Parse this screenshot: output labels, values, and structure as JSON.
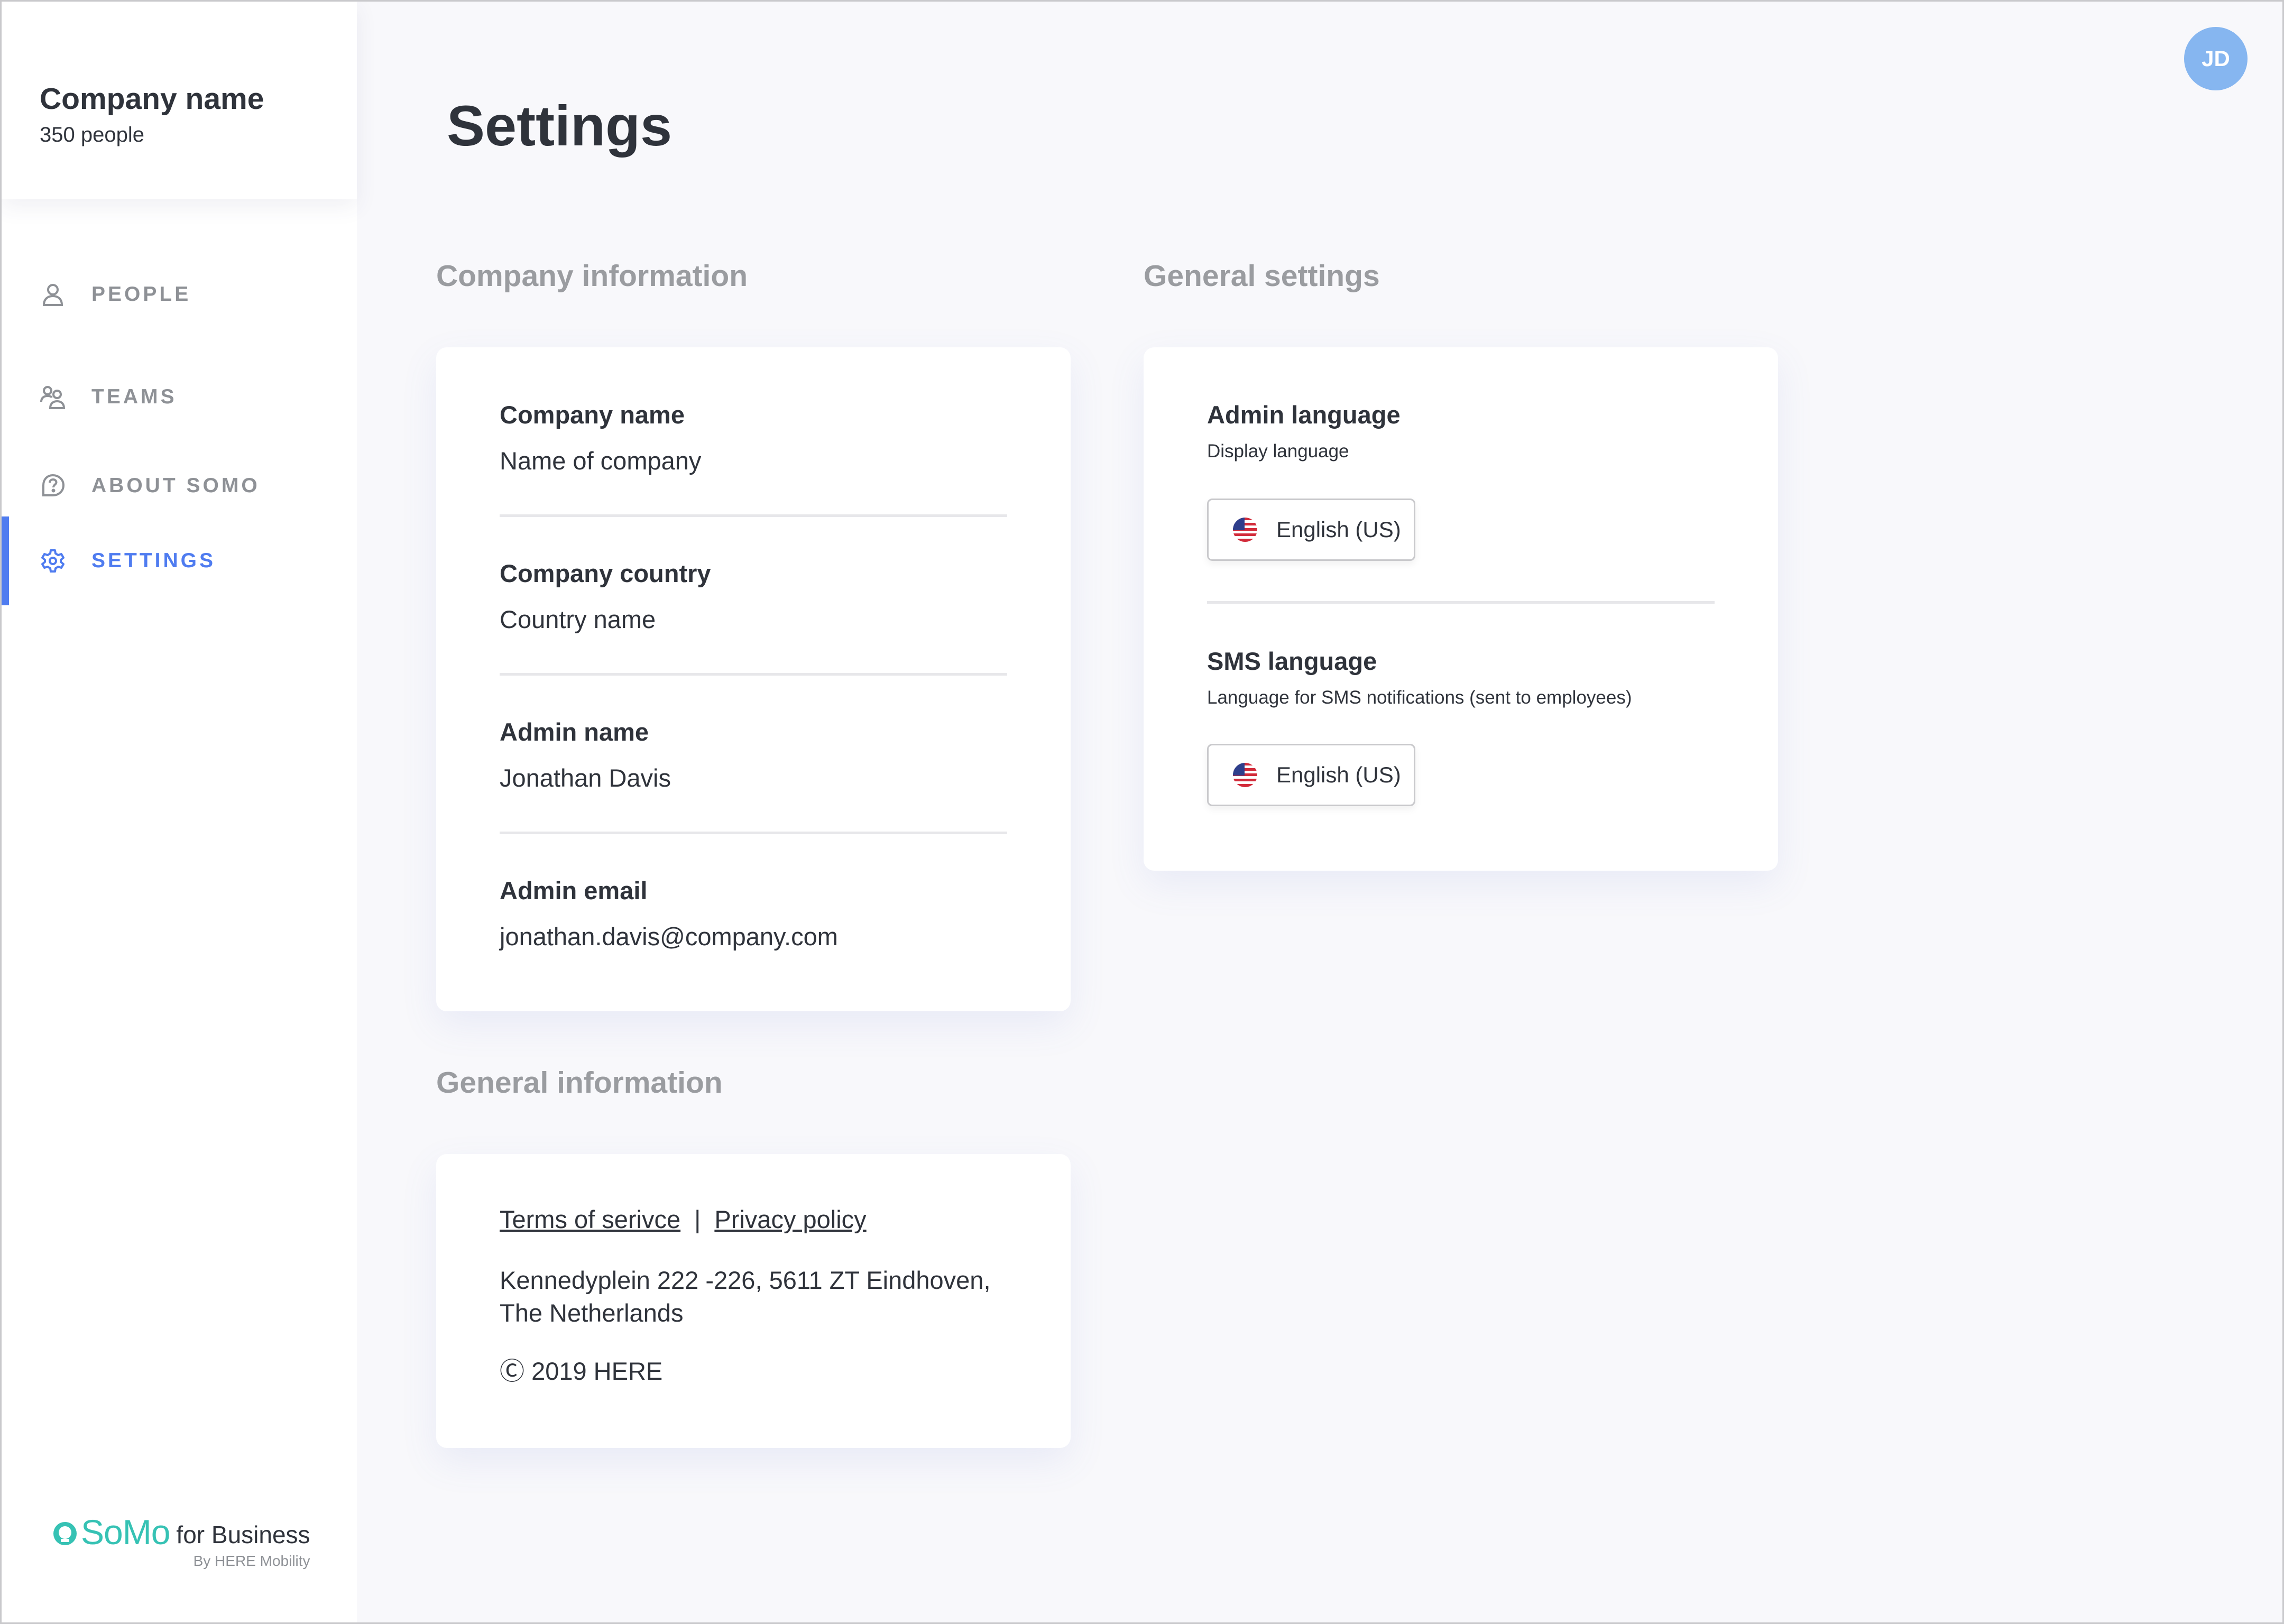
{
  "sidebar": {
    "company_title": "Company name",
    "company_sub": "350 people",
    "items": [
      {
        "label": "PEOPLE",
        "icon": "person-icon",
        "active": false
      },
      {
        "label": "TEAMS",
        "icon": "people-icon",
        "active": false
      },
      {
        "label": "ABOUT SOMO",
        "icon": "question-bubble-icon",
        "active": false
      },
      {
        "label": "SETTINGS",
        "icon": "gear-icon",
        "active": true
      }
    ],
    "brand": {
      "logo": "SoMo",
      "suffix": "for Business",
      "by": "By HERE Mobility"
    }
  },
  "header": {
    "avatar_initials": "JD"
  },
  "main": {
    "title": "Settings",
    "company_info": {
      "section_title": "Company information",
      "fields": [
        {
          "label": "Company name",
          "value": "Name of company"
        },
        {
          "label": "Company country",
          "value": "Country name"
        },
        {
          "label": "Admin name",
          "value": "Jonathan Davis"
        },
        {
          "label": "Admin email",
          "value": "jonathan.davis@company.com"
        }
      ]
    },
    "general_settings": {
      "section_title": "General settings",
      "admin_language": {
        "label": "Admin language",
        "sub": "Display language",
        "value": "English (US)"
      },
      "sms_language": {
        "label": "SMS language",
        "sub": "Language for SMS notifications (sent to employees)",
        "value": "English (US)"
      }
    },
    "general_info": {
      "section_title": "General information",
      "terms": "Terms of serivce",
      "separator": "|",
      "privacy": "Privacy policy",
      "address_line1": "Kennedyplein 222 -226, 5611 ZT Eindhoven,",
      "address_line2": "The Netherlands",
      "copyright_symbol": "Ⓒ",
      "copyright": "2019 HERE"
    }
  },
  "colors": {
    "accent": "#4f7cf0",
    "brand": "#36c2b4",
    "avatar": "#86b6f0",
    "muted": "#9a9ca0"
  }
}
